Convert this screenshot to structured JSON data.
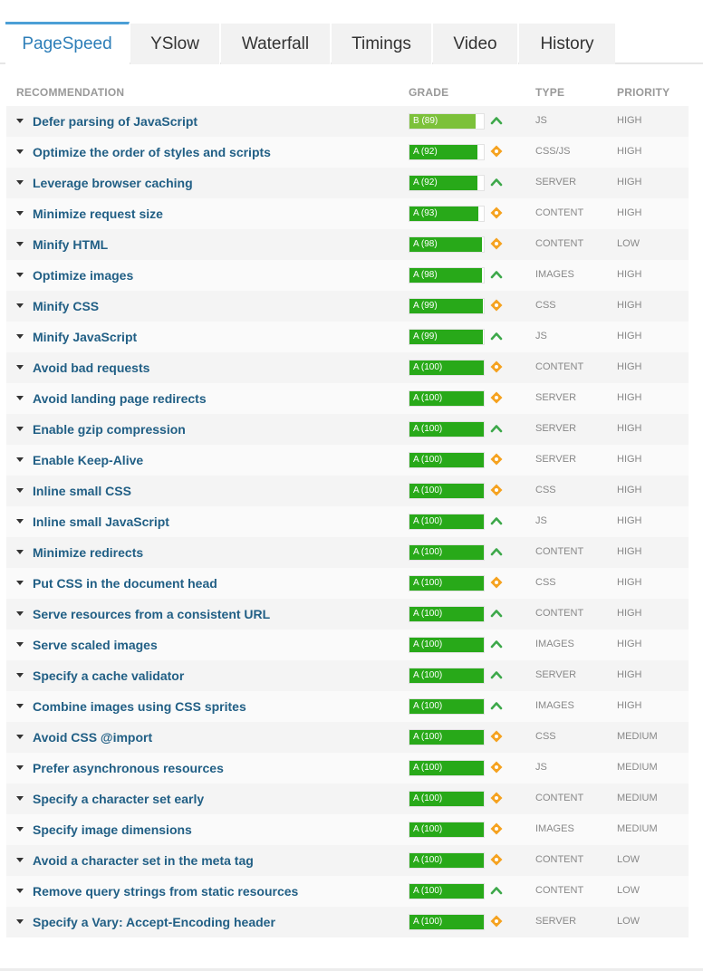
{
  "tabs": [
    {
      "label": "PageSpeed",
      "active": true
    },
    {
      "label": "YSlow"
    },
    {
      "label": "Waterfall"
    },
    {
      "label": "Timings"
    },
    {
      "label": "Video"
    },
    {
      "label": "History"
    }
  ],
  "headers": {
    "recommendation": "RECOMMENDATION",
    "grade": "GRADE",
    "type": "TYPE",
    "priority": "PRIORITY"
  },
  "colors": {
    "grade_b": "#7cc13a",
    "grade_a": "#28a919",
    "up_icon": "#3da84a",
    "diamond_icon": "#f5a21f"
  },
  "rows": [
    {
      "name": "Defer parsing of JavaScript",
      "grade": "B (89)",
      "score": 89,
      "icon": "up-arrow-icon",
      "type": "JS",
      "priority": "HIGH"
    },
    {
      "name": "Optimize the order of styles and scripts",
      "grade": "A (92)",
      "score": 92,
      "icon": "diamond-icon",
      "type": "CSS/JS",
      "priority": "HIGH"
    },
    {
      "name": "Leverage browser caching",
      "grade": "A (92)",
      "score": 92,
      "icon": "up-arrow-icon",
      "type": "SERVER",
      "priority": "HIGH"
    },
    {
      "name": "Minimize request size",
      "grade": "A (93)",
      "score": 93,
      "icon": "diamond-icon",
      "type": "CONTENT",
      "priority": "HIGH"
    },
    {
      "name": "Minify HTML",
      "grade": "A (98)",
      "score": 98,
      "icon": "diamond-icon",
      "type": "CONTENT",
      "priority": "LOW"
    },
    {
      "name": "Optimize images",
      "grade": "A (98)",
      "score": 98,
      "icon": "up-arrow-icon",
      "type": "IMAGES",
      "priority": "HIGH"
    },
    {
      "name": "Minify CSS",
      "grade": "A (99)",
      "score": 99,
      "icon": "diamond-icon",
      "type": "CSS",
      "priority": "HIGH"
    },
    {
      "name": "Minify JavaScript",
      "grade": "A (99)",
      "score": 99,
      "icon": "up-arrow-icon",
      "type": "JS",
      "priority": "HIGH"
    },
    {
      "name": "Avoid bad requests",
      "grade": "A (100)",
      "score": 100,
      "icon": "diamond-icon",
      "type": "CONTENT",
      "priority": "HIGH"
    },
    {
      "name": "Avoid landing page redirects",
      "grade": "A (100)",
      "score": 100,
      "icon": "diamond-icon",
      "type": "SERVER",
      "priority": "HIGH"
    },
    {
      "name": "Enable gzip compression",
      "grade": "A (100)",
      "score": 100,
      "icon": "up-arrow-icon",
      "type": "SERVER",
      "priority": "HIGH"
    },
    {
      "name": "Enable Keep-Alive",
      "grade": "A (100)",
      "score": 100,
      "icon": "diamond-icon",
      "type": "SERVER",
      "priority": "HIGH"
    },
    {
      "name": "Inline small CSS",
      "grade": "A (100)",
      "score": 100,
      "icon": "diamond-icon",
      "type": "CSS",
      "priority": "HIGH"
    },
    {
      "name": "Inline small JavaScript",
      "grade": "A (100)",
      "score": 100,
      "icon": "up-arrow-icon",
      "type": "JS",
      "priority": "HIGH"
    },
    {
      "name": "Minimize redirects",
      "grade": "A (100)",
      "score": 100,
      "icon": "up-arrow-icon",
      "type": "CONTENT",
      "priority": "HIGH"
    },
    {
      "name": "Put CSS in the document head",
      "grade": "A (100)",
      "score": 100,
      "icon": "diamond-icon",
      "type": "CSS",
      "priority": "HIGH"
    },
    {
      "name": "Serve resources from a consistent URL",
      "grade": "A (100)",
      "score": 100,
      "icon": "up-arrow-icon",
      "type": "CONTENT",
      "priority": "HIGH"
    },
    {
      "name": "Serve scaled images",
      "grade": "A (100)",
      "score": 100,
      "icon": "up-arrow-icon",
      "type": "IMAGES",
      "priority": "HIGH"
    },
    {
      "name": "Specify a cache validator",
      "grade": "A (100)",
      "score": 100,
      "icon": "up-arrow-icon",
      "type": "SERVER",
      "priority": "HIGH"
    },
    {
      "name": "Combine images using CSS sprites",
      "grade": "A (100)",
      "score": 100,
      "icon": "up-arrow-icon",
      "type": "IMAGES",
      "priority": "HIGH"
    },
    {
      "name": "Avoid CSS @import",
      "grade": "A (100)",
      "score": 100,
      "icon": "diamond-icon",
      "type": "CSS",
      "priority": "MEDIUM"
    },
    {
      "name": "Prefer asynchronous resources",
      "grade": "A (100)",
      "score": 100,
      "icon": "diamond-icon",
      "type": "JS",
      "priority": "MEDIUM"
    },
    {
      "name": "Specify a character set early",
      "grade": "A (100)",
      "score": 100,
      "icon": "diamond-icon",
      "type": "CONTENT",
      "priority": "MEDIUM"
    },
    {
      "name": "Specify image dimensions",
      "grade": "A (100)",
      "score": 100,
      "icon": "diamond-icon",
      "type": "IMAGES",
      "priority": "MEDIUM"
    },
    {
      "name": "Avoid a character set in the meta tag",
      "grade": "A (100)",
      "score": 100,
      "icon": "diamond-icon",
      "type": "CONTENT",
      "priority": "LOW"
    },
    {
      "name": "Remove query strings from static resources",
      "grade": "A (100)",
      "score": 100,
      "icon": "up-arrow-icon",
      "type": "CONTENT",
      "priority": "LOW"
    },
    {
      "name": "Specify a Vary: Accept-Encoding header",
      "grade": "A (100)",
      "score": 100,
      "icon": "diamond-icon",
      "type": "SERVER",
      "priority": "LOW"
    }
  ]
}
